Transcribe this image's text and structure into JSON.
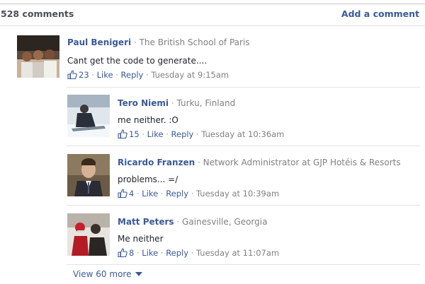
{
  "header": {
    "count_label": "528 comments",
    "add_label": "Add a comment"
  },
  "separator": "·",
  "comments": [
    {
      "author": "Paul Benigeri",
      "network": "The British School of Paris",
      "text": "Cant get the code to generate....",
      "likes": "23",
      "like_label": "Like",
      "reply_label": "Reply",
      "time": "Tuesday at 9:15am"
    },
    {
      "author": "Tero Niemi",
      "network": "Turku, Finland",
      "text": "me neither. :O",
      "likes": "15",
      "like_label": "Like",
      "reply_label": "Reply",
      "time": "Tuesday at 10:36am"
    },
    {
      "author": "Ricardo Franzen",
      "network": "Network Administrator at GJP Hotéis & Resorts",
      "text": "problems... =/",
      "likes": "4",
      "like_label": "Like",
      "reply_label": "Reply",
      "time": "Tuesday at 10:39am"
    },
    {
      "author": "Matt Peters",
      "network": "Gainesville, Georgia",
      "text": "Me neither",
      "likes": "8",
      "like_label": "Like",
      "reply_label": "Reply",
      "time": "Tuesday at 11:07am"
    }
  ],
  "view_more_label": "View 60 more",
  "colors": {
    "link": "#3b5998",
    "muted": "#808080",
    "divider": "#e3e3e3"
  },
  "icons": {
    "like": "thumbs-up-icon",
    "view_more": "caret-down-icon"
  }
}
